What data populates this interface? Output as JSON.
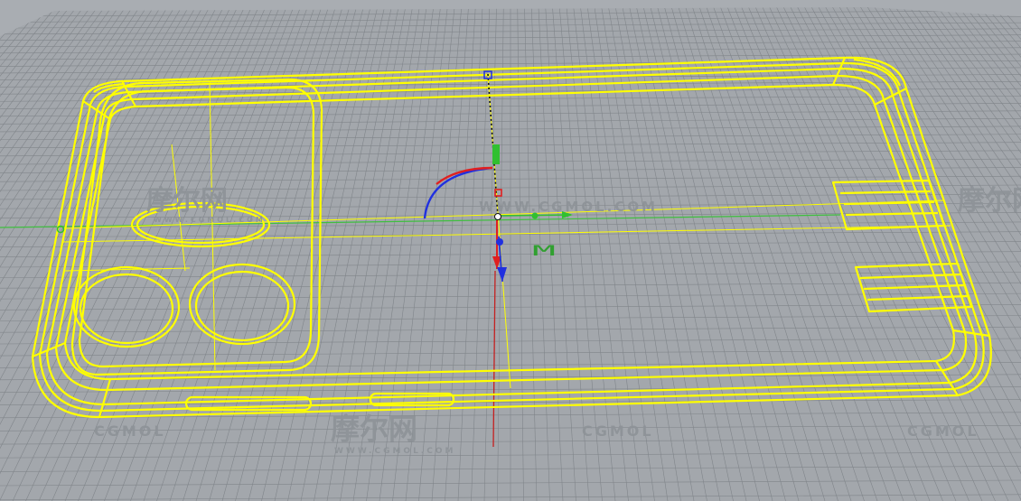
{
  "viewport": {
    "background": "#a3a7ac",
    "grid_color": "#7f8489",
    "model_color": "#ffff00",
    "axis_x_color": "#30c030",
    "axis_y_color": "#c02020",
    "gumball_blue": "#2030e0",
    "gumball_red": "#e02020",
    "gumball_green": "#30c030"
  },
  "watermarks": {
    "cn_brand": "摩尔网",
    "domain": "WWW.CGMOL.COM",
    "brand_latin": "CGMOL"
  },
  "gumball_label": "M"
}
